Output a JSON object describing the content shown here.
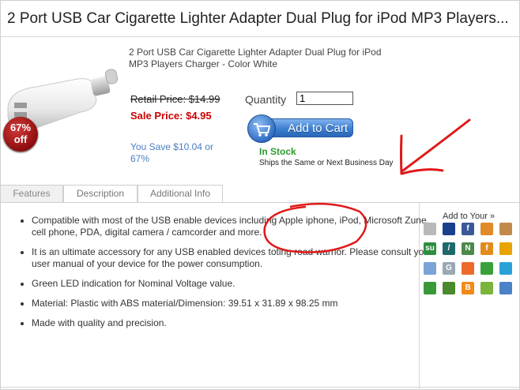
{
  "title": "2 Port USB Car Cigarette Lighter Adapter Dual Plug for iPod MP3 Players...",
  "product": {
    "description": "2 Port USB Car Cigarette Lighter Adapter Dual Plug for iPod MP3 Players Charger - Color White",
    "badge_percent": "67%",
    "badge_off": "off",
    "retail_price": "Retail Price: $14.99",
    "sale_price": "Sale Price: $4.95",
    "you_save": "You Save $10.04 or 67%",
    "quantity_label": "Quantity",
    "quantity_value": "1",
    "add_to_cart": "Add to Cart",
    "stock_status": "In Stock",
    "shipping_note": "Ships the Same or Next Business Day"
  },
  "tabs": [
    {
      "label": "Features"
    },
    {
      "label": "Description"
    },
    {
      "label": "Additional Info"
    }
  ],
  "features": [
    "Compatible with most of the USB enable devices including Apple iphone, iPod, Microsoft Zune, cell phone, PDA, digital camera / camcorder and more.",
    "It is an ultimate accessory for any USB enabled devices toting road warrior. Please consult your user manual of your device for the power consumption.",
    "Green LED indication for Nominal Voltage value.",
    "Material: Plastic with ABS material/Dimension: 39.51 x 31.89 x 98.25 mm",
    "Made with quality and precision."
  ],
  "share": {
    "label": "Add to Your »",
    "icons": [
      {
        "name": "delicious-icon",
        "glyph": "",
        "color": "#b9b9b9"
      },
      {
        "name": "digg-icon",
        "glyph": "",
        "color": "#1a3f8f"
      },
      {
        "name": "facebook-icon",
        "glyph": "f",
        "color": "#3b5998"
      },
      {
        "name": "buzz-icon",
        "glyph": "",
        "color": "#e08a2a"
      },
      {
        "name": "myspace-icon",
        "glyph": "",
        "color": "#c28a4a"
      },
      {
        "name": "stumbleupon-icon",
        "glyph": "su",
        "color": "#2d8e3f"
      },
      {
        "name": "slashdot-icon",
        "glyph": "/",
        "color": "#1e6a6a"
      },
      {
        "name": "newsvine-icon",
        "glyph": "N",
        "color": "#4b8a4b"
      },
      {
        "name": "fark-icon",
        "glyph": "f",
        "color": "#e28c1e"
      },
      {
        "name": "download-icon",
        "glyph": "",
        "color": "#e8a400"
      },
      {
        "name": "blogger-icon",
        "glyph": "",
        "color": "#7aa4d6"
      },
      {
        "name": "google-icon",
        "glyph": "G",
        "color": "#9aa7b4"
      },
      {
        "name": "reddit-icon",
        "glyph": "",
        "color": "#ec6a2c"
      },
      {
        "name": "technorati-icon",
        "glyph": "",
        "color": "#3aa13a"
      },
      {
        "name": "linkedin-icon",
        "glyph": "",
        "color": "#2aa0d8"
      },
      {
        "name": "bookmark-icon",
        "glyph": "",
        "color": "#3a9a3a"
      },
      {
        "name": "tree-icon",
        "glyph": "",
        "color": "#4a8a2a"
      },
      {
        "name": "blogmarks-icon",
        "glyph": "B",
        "color": "#f28a1a"
      },
      {
        "name": "diigo-icon",
        "glyph": "",
        "color": "#7ab43a"
      },
      {
        "name": "monitor-icon",
        "glyph": "",
        "color": "#4a82c8"
      }
    ]
  }
}
